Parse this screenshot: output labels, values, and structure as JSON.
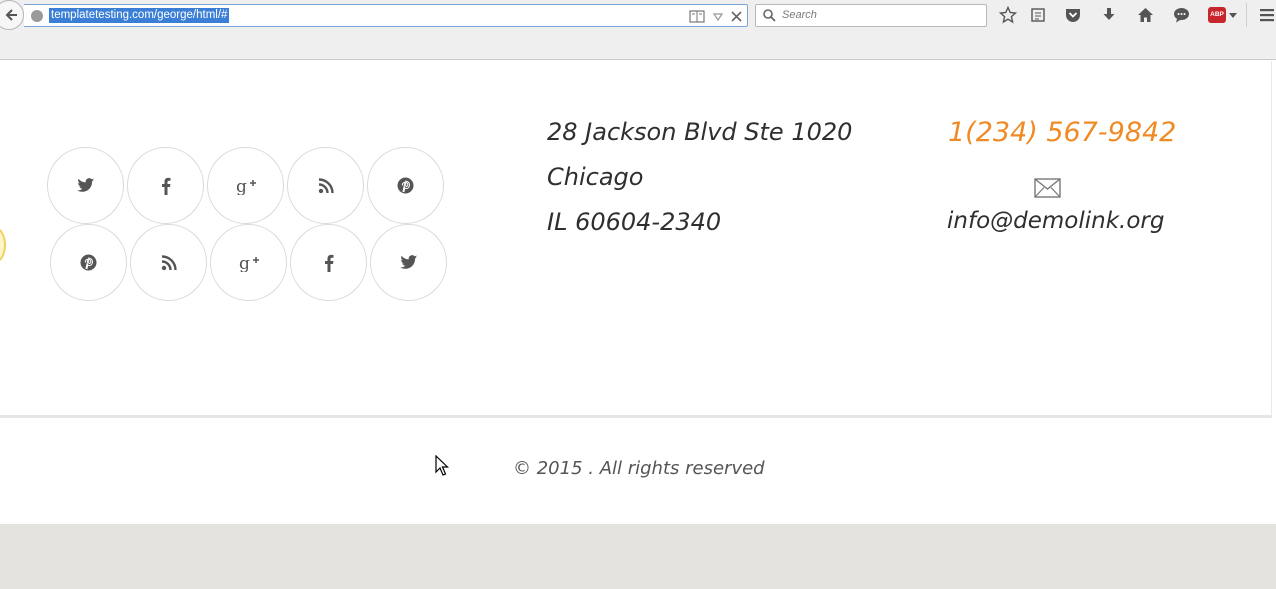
{
  "browser": {
    "url": "templatetesting.com/george/html/#",
    "search_placeholder": "Search",
    "toolbar_icons": [
      "bookmark-star-icon",
      "reading-list-icon",
      "pocket-icon",
      "download-icon",
      "home-icon",
      "chat-icon",
      "adblock-icon",
      "menu-icon"
    ],
    "adblock_label": "ABP"
  },
  "social": {
    "row1": [
      "twitter-icon",
      "facebook-icon",
      "google-plus-icon",
      "rss-icon",
      "pinterest-icon"
    ],
    "row2": [
      "pinterest-icon",
      "rss-icon",
      "google-plus-icon",
      "facebook-icon",
      "twitter-icon"
    ]
  },
  "address": {
    "line1": "28 Jackson Blvd Ste 1020",
    "line2": "Chicago",
    "line3": "IL 60604-2340"
  },
  "contact": {
    "phone": "1(234) 567-9842",
    "email_icon": "envelope-icon",
    "email": "info@demolink.org"
  },
  "footer": {
    "copyright": "© 2015 . All rights reserved"
  },
  "colors": {
    "accent": "#f08a24",
    "text": "#2f2f2f",
    "bottom_band": "#e5e3df"
  }
}
